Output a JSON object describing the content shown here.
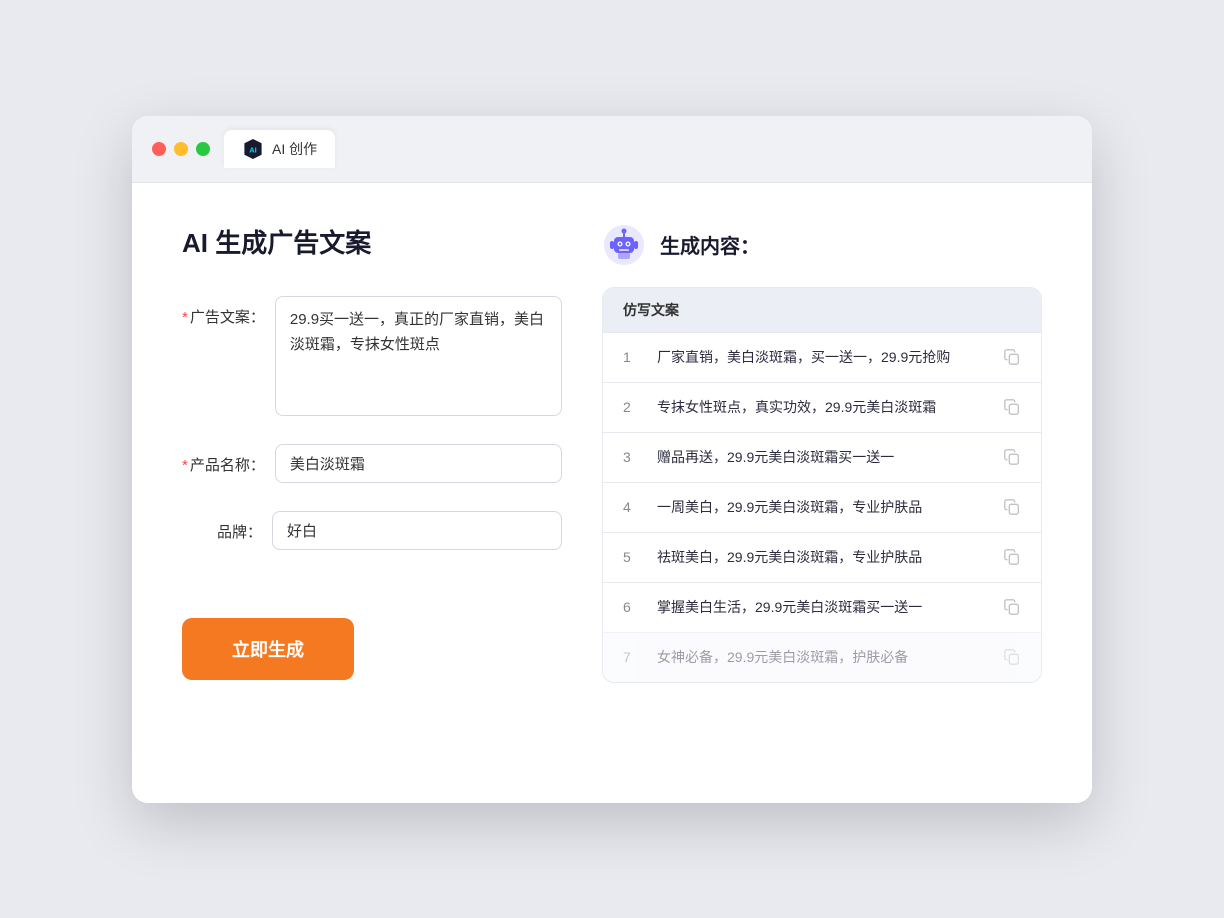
{
  "browser": {
    "tab_label": "AI 创作"
  },
  "page": {
    "title": "AI 生成广告文案"
  },
  "form": {
    "ad_copy_label": "广告文案：",
    "ad_copy_required": "*",
    "ad_copy_value": "29.9买一送一，真正的厂家直销，美白淡斑霜，专抹女性斑点",
    "product_name_label": "产品名称：",
    "product_name_required": "*",
    "product_name_value": "美白淡斑霜",
    "brand_label": "品牌：",
    "brand_value": "好白",
    "generate_button": "立即生成"
  },
  "result": {
    "header": "生成内容：",
    "table_col": "仿写文案",
    "rows": [
      {
        "num": "1",
        "text": "厂家直销，美白淡斑霜，买一送一，29.9元抢购",
        "faded": false
      },
      {
        "num": "2",
        "text": "专抹女性斑点，真实功效，29.9元美白淡斑霜",
        "faded": false
      },
      {
        "num": "3",
        "text": "赠品再送，29.9元美白淡斑霜买一送一",
        "faded": false
      },
      {
        "num": "4",
        "text": "一周美白，29.9元美白淡斑霜，专业护肤品",
        "faded": false
      },
      {
        "num": "5",
        "text": "祛斑美白，29.9元美白淡斑霜，专业护肤品",
        "faded": false
      },
      {
        "num": "6",
        "text": "掌握美白生活，29.9元美白淡斑霜买一送一",
        "faded": false
      },
      {
        "num": "7",
        "text": "女神必备，29.9元美白淡斑霜，护肤必备",
        "faded": true
      }
    ]
  }
}
